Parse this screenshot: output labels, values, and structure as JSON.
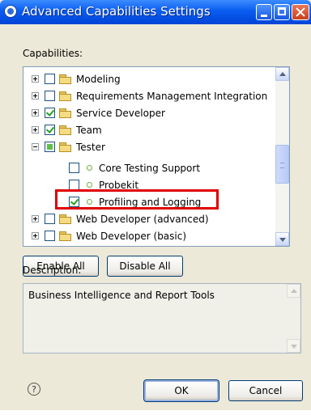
{
  "window": {
    "title": "Advanced Capabilities Settings"
  },
  "capabilities_label": "Capabilities:",
  "tree_items": [
    {
      "label": "Modeling",
      "expander": "plus",
      "state": "unchecked",
      "kind": "folder"
    },
    {
      "label": "Requirements Management Integration",
      "expander": "plus",
      "state": "unchecked",
      "kind": "folder"
    },
    {
      "label": "Service Developer",
      "expander": "plus",
      "state": "checked",
      "kind": "folder"
    },
    {
      "label": "Team",
      "expander": "plus",
      "state": "checked",
      "kind": "folder"
    },
    {
      "label": "Tester",
      "expander": "minus",
      "state": "partial",
      "kind": "folder"
    },
    {
      "label": "Core Testing Support",
      "expander": "none",
      "state": "unchecked",
      "kind": "item"
    },
    {
      "label": "Probekit",
      "expander": "none",
      "state": "unchecked",
      "kind": "item"
    },
    {
      "label": "Profiling and Logging",
      "expander": "none",
      "state": "checked",
      "kind": "item"
    },
    {
      "label": "Web Developer (advanced)",
      "expander": "plus",
      "state": "unchecked",
      "kind": "folder"
    },
    {
      "label": "Web Developer (basic)",
      "expander": "plus",
      "state": "unchecked",
      "kind": "folder"
    }
  ],
  "buttons": {
    "enable_all": "Enable All",
    "disable_all": "Disable All",
    "ok": "OK",
    "cancel": "Cancel"
  },
  "description_label": "Description:",
  "description_text": "Business Intelligence and Report Tools",
  "help_glyph": "?",
  "colors": {
    "title_bar": "#0a5cf0",
    "highlight": "#e00000",
    "check": "#21a121"
  }
}
